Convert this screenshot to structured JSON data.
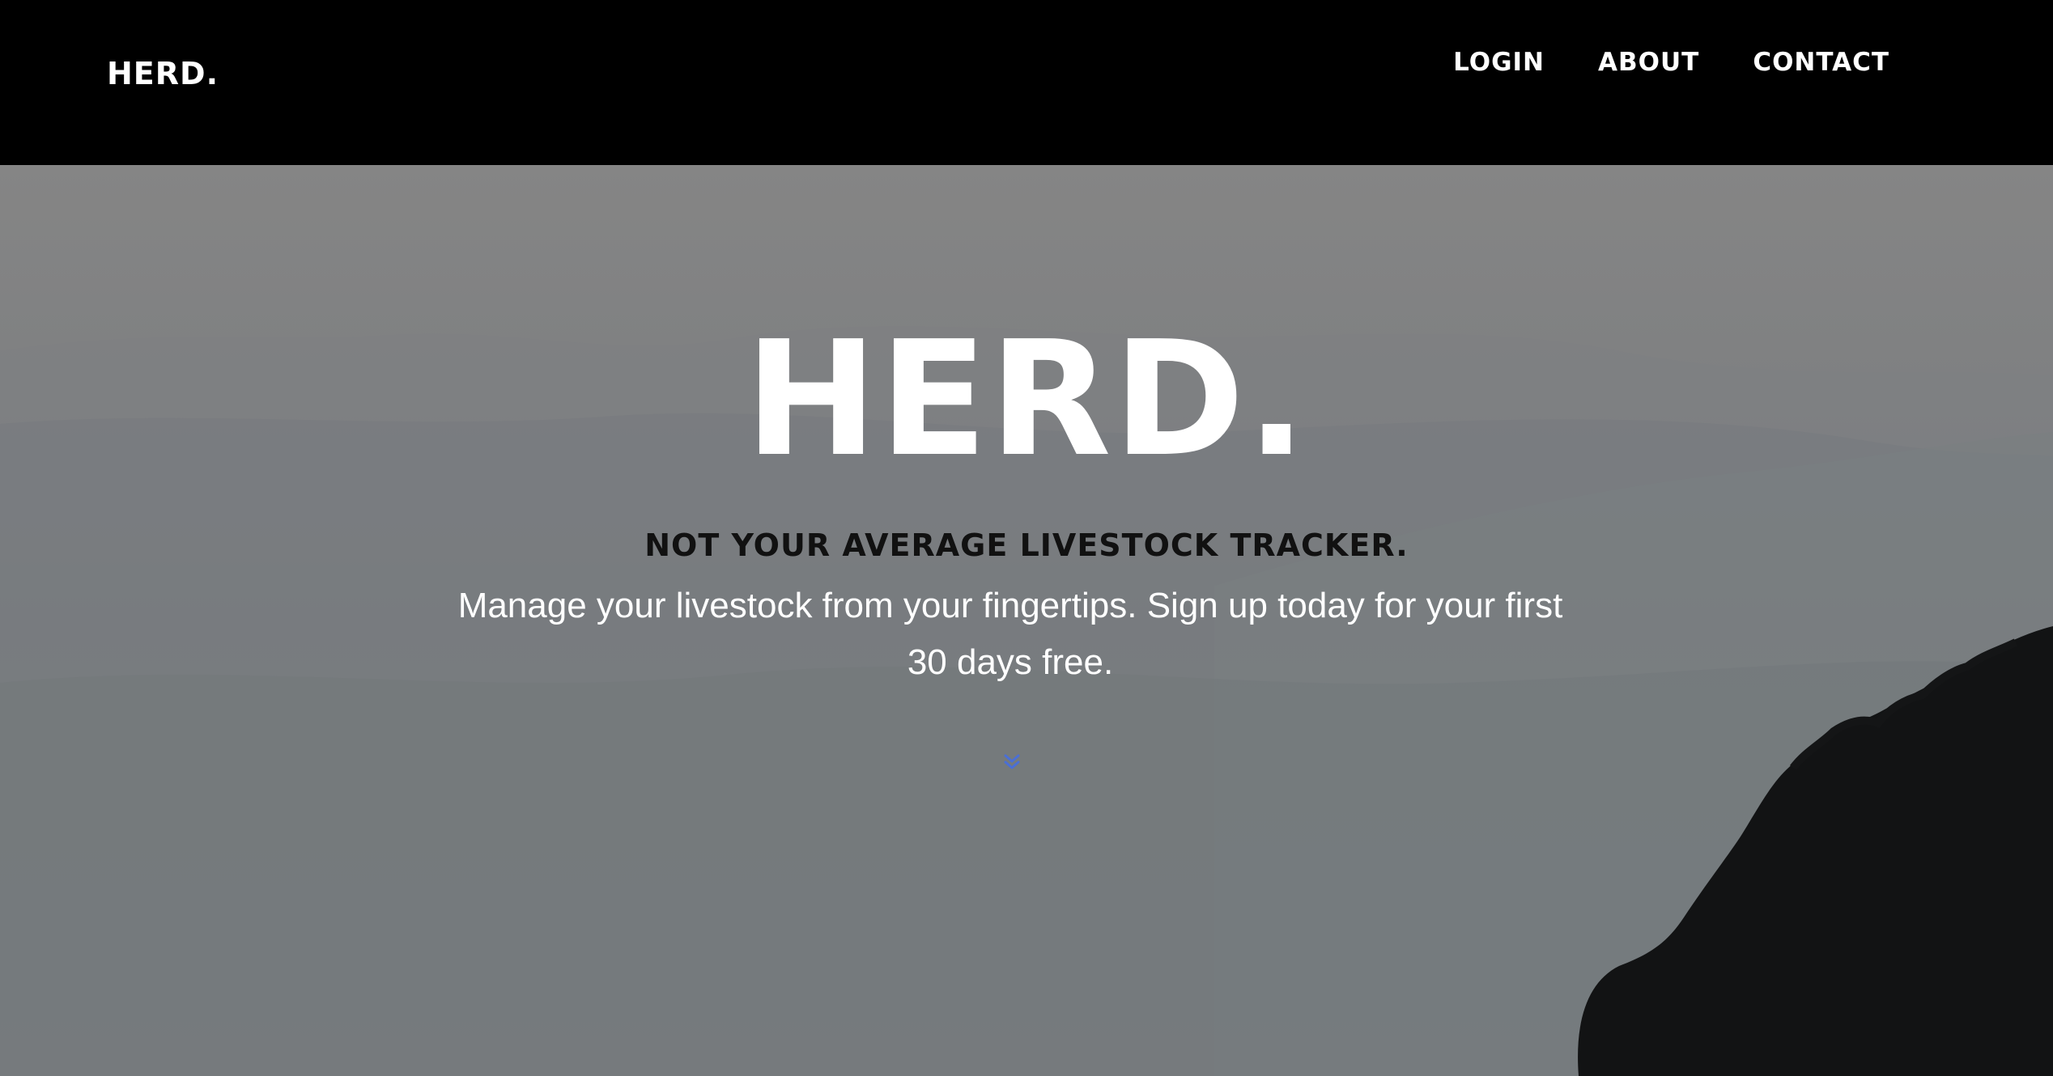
{
  "navbar": {
    "brand": "HERD.",
    "links": [
      {
        "label": "LOGIN"
      },
      {
        "label": "ABOUT"
      },
      {
        "label": "CONTACT"
      }
    ]
  },
  "hero": {
    "title": "HERD.",
    "tagline": "NOT YOUR AVERAGE LIVESTOCK TRACKER.",
    "description": "Manage your livestock from your fingertips. Sign up today for your first 30 days free.",
    "scroll_icon": "chevron-double-down-icon"
  },
  "colors": {
    "navbar_bg": "#000000",
    "text_primary": "#ffffff",
    "tagline_text": "#111111",
    "scroll_icon": "#4a6fd6"
  }
}
